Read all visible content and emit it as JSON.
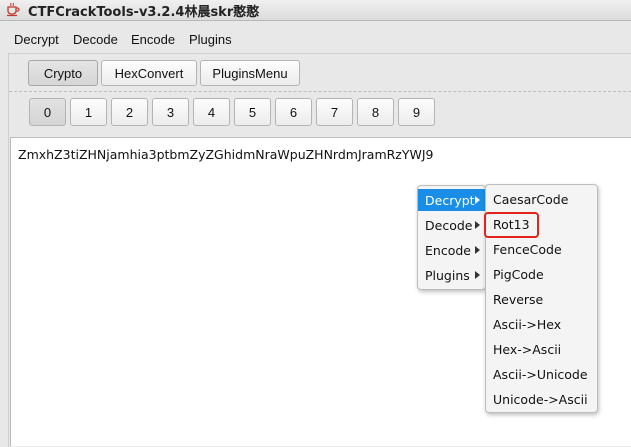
{
  "window": {
    "title": "CTFCrackTools-v3.2.4林晨skr憨憨",
    "icon": "coffee-cup-icon"
  },
  "menubar": {
    "items": [
      "Decrypt",
      "Decode",
      "Encode",
      "Plugins"
    ]
  },
  "top_tabs": {
    "items": [
      "Crypto",
      "HexConvert",
      "PluginsMenu"
    ],
    "selected": "Crypto"
  },
  "number_tabs": {
    "items": [
      "0",
      "1",
      "2",
      "3",
      "4",
      "5",
      "6",
      "7",
      "8",
      "9"
    ],
    "selected": "0"
  },
  "editor": {
    "text": "ZmxhZ3tiZHNjamhia3ptbmZyZGhidmNraWpuZHNrdmJramRzYWJ9"
  },
  "context_menu": {
    "items": [
      "Decrypt",
      "Decode",
      "Encode",
      "Plugins"
    ],
    "active": "Decrypt"
  },
  "submenu": {
    "items": [
      "CaesarCode",
      "Rot13",
      "FenceCode",
      "PigCode",
      "Reverse",
      "Ascii->Hex",
      "Hex->Ascii",
      "Ascii->Unicode",
      "Unicode->Ascii"
    ],
    "highlighted": "Rot13"
  },
  "colors": {
    "menu_selection": "#1a8ee6",
    "highlight_border": "#e0241b"
  }
}
